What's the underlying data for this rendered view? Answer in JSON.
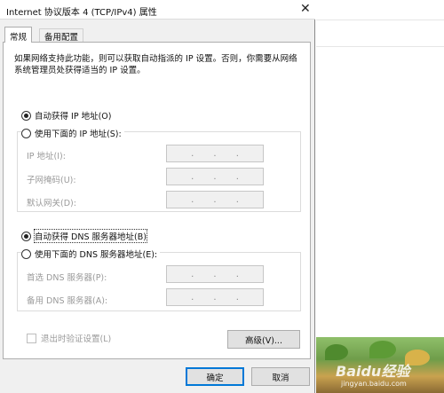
{
  "window": {
    "title": "Internet 协议版本 4 (TCP/IPv4) 属性",
    "close_glyph": "✕"
  },
  "tabs": [
    {
      "label": "常规",
      "active": true
    },
    {
      "label": "备用配置",
      "active": false
    }
  ],
  "description": "如果网络支持此功能，则可以获取自动指派的 IP 设置。否则，你需要从网络系统管理员处获得适当的 IP 设置。",
  "ip_section": {
    "auto_option": {
      "label": "自动获得 IP 地址(O)",
      "selected": true
    },
    "manual_option": {
      "label": "使用下面的 IP 地址(S):",
      "selected": false
    },
    "fields": [
      {
        "label": "IP 地址(I):",
        "value": ". . ."
      },
      {
        "label": "子网掩码(U):",
        "value": ". . ."
      },
      {
        "label": "默认网关(D):",
        "value": ". . ."
      }
    ]
  },
  "dns_section": {
    "auto_option": {
      "label": "自动获得 DNS 服务器地址(B)",
      "selected": true
    },
    "manual_option": {
      "label": "使用下面的 DNS 服务器地址(E):",
      "selected": false
    },
    "fields": [
      {
        "label": "首选 DNS 服务器(P):",
        "value": ". . ."
      },
      {
        "label": "备用 DNS 服务器(A):",
        "value": ". . ."
      }
    ]
  },
  "validate_checkbox": {
    "label": "退出时验证设置(L)",
    "checked": false
  },
  "buttons": {
    "advanced": "高级(V)...",
    "ok": "确定",
    "cancel": "取消"
  },
  "background_watermark": {
    "brand": "Baidu经验",
    "url": "jingyan.baidu.com"
  },
  "colors": {
    "dialog_bg": "#f0f0f0",
    "panel_bg": "#ffffff",
    "focus_border": "#0078d7"
  }
}
